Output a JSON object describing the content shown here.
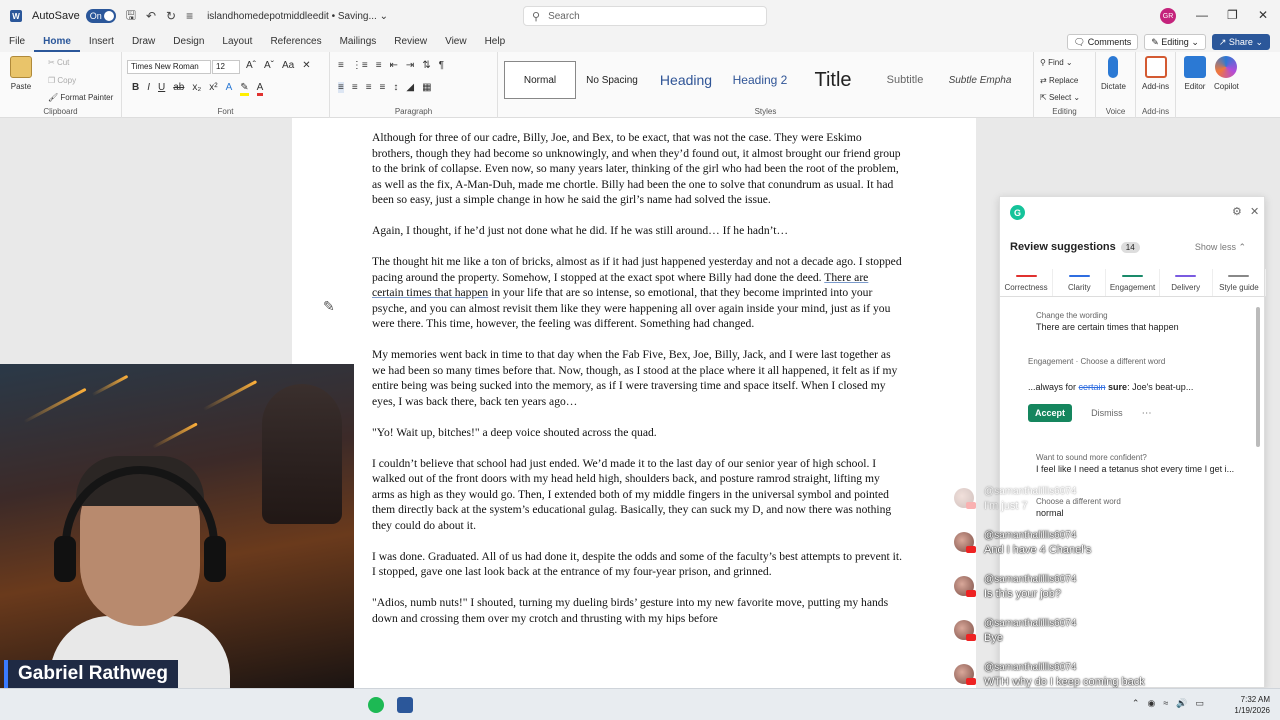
{
  "titlebar": {
    "autosave_label": "AutoSave",
    "autosave_state": "On",
    "doc_name": "islandhomedepotmiddleedit",
    "status": "Saving...",
    "search_placeholder": "Search",
    "avatar_initials": "GR"
  },
  "menu": {
    "tabs": [
      "File",
      "Home",
      "Insert",
      "Draw",
      "Design",
      "Layout",
      "References",
      "Mailings",
      "Review",
      "View",
      "Help"
    ],
    "active_tab": "Home",
    "comments": "Comments",
    "editing": "Editing",
    "share": "Share"
  },
  "ribbon": {
    "paste": "Paste",
    "cut": "Cut",
    "copy": "Copy",
    "format_painter": "Format Painter",
    "clipboard": "Clipboard",
    "font_name": "Times New Roman",
    "font_size": "12",
    "font_group": "Font",
    "paragraph_group": "Paragraph",
    "styles_group": "Styles",
    "styles": [
      "Normal",
      "No Spacing",
      "Heading",
      "Heading 2",
      "Title",
      "Subtitle",
      "Subtle Empha"
    ],
    "find": "Find",
    "replace": "Replace",
    "select": "Select",
    "editing_group": "Editing",
    "dictate": "Dictate",
    "voice_group": "Voice",
    "addins": "Add-ins",
    "addins_group": "Add-ins",
    "editor": "Editor",
    "copilot": "Copilot"
  },
  "document": {
    "p1": "Although for three of our cadre, Billy, Joe, and Bex, to be exact, that was not the case. They were Eskimo brothers, though they had become so unknowingly, and when they’d found out, it almost brought our friend group to the brink of collapse. Even now, so many years later, thinking of the girl who had been the root of the problem, as well as the fix, A-Man-Duh, made me chortle. Billy had been the one to solve that conundrum as usual. It had been so easy, just a simple change in how he said the girl’s name had solved the issue.",
    "p2": "Again, I thought, if he’d just not done what he did. If he was still around… If he hadn’t…",
    "p3a": "The thought hit me like a ton of bricks, almost as if it had just happened yesterday and not a decade ago. I stopped pacing around the property. Somehow, I stopped at the exact spot where Billy had done the deed. ",
    "p3b": "There are certain times that happen",
    "p3c": " in your life that are so intense, so emotional, that they become imprinted into your psyche, and you can almost revisit them like they were happening all over again inside your mind, just as if you were there. This time, however, the feeling was different. Something had changed.",
    "p4": "My memories went back in time to that day when the Fab Five, Bex, Joe, Billy, Jack, and I were last together as we had been so many times before that. Now, though, as I stood at the place where it all happened, it felt as if my entire being was being sucked into the memory, as if I were traversing time and space itself. When I closed my eyes, I was back there, back ten years ago…",
    "p5": "\"Yo! Wait up, bitches!\" a deep voice shouted across the quad.",
    "p6": "I couldn’t believe that school had just ended. We’d made it to the last day of our senior year of high school. I walked out of the front doors with my head held high, shoulders back, and posture ramrod straight, lifting my arms as high as they would go. Then, I extended both of my middle fingers in the universal symbol and pointed them directly back at the system’s educational gulag. Basically, they can suck my D, and now there was nothing they could do about it.",
    "p7": "I was done. Graduated. All of us had done it, despite the odds and some of the faculty’s best attempts to prevent it. I stopped, gave one last look back at the entrance of my four-year prison, and grinned.",
    "p8": "\"Adios, numb nuts!\" I shouted, turning my dueling birds’ gesture into my new favorite move, putting my hands down and crossing them over my crotch and thrusting with my hips before"
  },
  "webcam": {
    "name": "Gabriel Rathweg"
  },
  "grammarly": {
    "title": "Review suggestions",
    "count": "14",
    "show_less": "Show less",
    "categories": [
      {
        "label": "Correctness",
        "color": "#e0312f"
      },
      {
        "label": "Clarity",
        "color": "#2f6de0"
      },
      {
        "label": "Engagement",
        "color": "#1a8a6a"
      },
      {
        "label": "Delivery",
        "color": "#7a5be0"
      },
      {
        "label": "Style guide",
        "color": "#888888"
      }
    ],
    "card1_small": "Change the wording",
    "card1_text": "There are certain times that happen",
    "card2_small": "Engagement · Choose a different word",
    "card2_pre": "...always for ",
    "card2_strike": "certain",
    "card2_new": "sure",
    "card2_post": ": Joe's beat-up...",
    "accept": "Accept",
    "dismiss": "Dismiss",
    "card3_small": "Want to sound more confident?",
    "card3_text": "I feel like I need a tetanus shot every time I get i...",
    "card4_small": "Choose a different word",
    "card4_text": "normal"
  },
  "chat": [
    {
      "user": "@samanthalillis6074",
      "text": "I'm just 7",
      "faded": true
    },
    {
      "user": "@samanthalillis6074",
      "text": "And I have 4 Chanel's",
      "faded": false
    },
    {
      "user": "@samanthalillis6074",
      "text": "Is this your job?",
      "faded": false
    },
    {
      "user": "@samanthalillis6074",
      "text": "Bye",
      "faded": false
    },
    {
      "user": "@samanthalillis6074",
      "text": "WTH why do I keep coming back",
      "faded": false
    }
  ],
  "taskbar": {
    "time": "7:32 AM",
    "date": "1/19/2026"
  }
}
